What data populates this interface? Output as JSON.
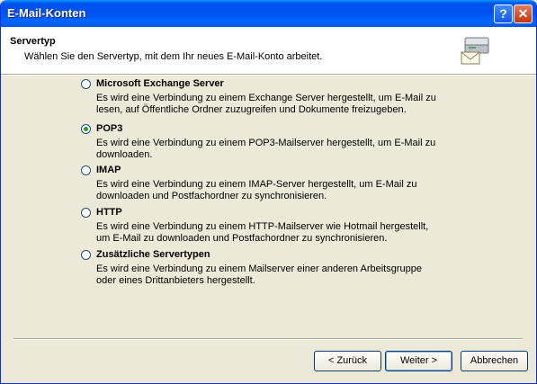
{
  "window": {
    "title": "E-Mail-Konten"
  },
  "titlebar": {
    "help_glyph": "?",
    "close_glyph": "✕"
  },
  "header": {
    "title": "Servertyp",
    "description": "Wählen Sie den Servertyp, mit dem Ihr neues E-Mail-Konto arbeitet.",
    "icon": "mail-server-icon"
  },
  "options": [
    {
      "label": "Microsoft Exchange Server",
      "line1": "Es wird eine Verbindung zu einem Exchange Server hergestellt, um E-Mail zu",
      "line2": "lesen, auf Öffentliche Ordner zuzugreifen und Dokumente freizugeben.",
      "checked": false
    },
    {
      "label": "POP3",
      "line1": "Es wird eine Verbindung zu einem POP3-Mailserver hergestellt, um E-Mail zu",
      "line2": "downloaden.",
      "checked": true
    },
    {
      "label": "IMAP",
      "line1": "Es wird eine Verbindung zu einem IMAP-Server hergestellt, um E-Mail zu",
      "line2": "downloaden und Postfachordner zu synchronisieren.",
      "checked": false
    },
    {
      "label": "HTTP",
      "line1": "Es wird eine Verbindung zu einem HTTP-Mailserver wie Hotmail hergestellt,",
      "line2": "um E-Mail zu downloaden und Postfachordner zu synchronisieren.",
      "checked": false
    },
    {
      "label": "Zusätzliche Servertypen",
      "line1": "Es wird eine Verbindung zu einem Mailserver einer anderen Arbeitsgruppe",
      "line2": "oder eines Drittanbieters hergestellt.",
      "checked": false
    }
  ],
  "buttons": {
    "back": "< Zurück",
    "next": "Weiter >",
    "cancel": "Abbrechen"
  }
}
